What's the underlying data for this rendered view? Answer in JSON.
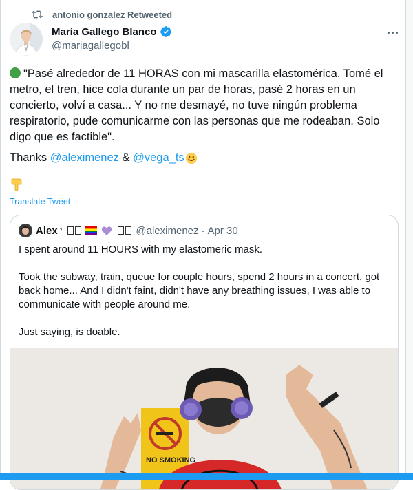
{
  "retweet": {
    "label": "antonio gonzalez Retweeted"
  },
  "author": {
    "name": "María Gallego Blanco",
    "handle": "@mariagallegobl"
  },
  "tweet": {
    "body": "\"Pasé alrededor de 11 HORAS con mi mascarilla elastomérica.  Tomé el metro, el tren, hice cola durante un par de horas, pasé 2 horas en un concierto, volví a casa... Y no me desmayé, no tuve ningún problema respiratorio, pude comunicarme con las personas que me rodeaban.  Solo digo que es factible\".",
    "thanks_prefix": "Thanks ",
    "mention_1": "@aleximenez",
    "thanks_and": " & ",
    "mention_2": "@vega_ts",
    "translate": "Translate Tweet"
  },
  "quote": {
    "name": "Alex",
    "superscript": "⁷",
    "handle": "@aleximenez",
    "separator": "·",
    "date": "Apr 30",
    "paragraphs": [
      "I spent around 11 HOURS with my elastomeric mask.",
      "Took the subway, train, queue for couple hours, spend 2 hours in a concert, got back home... And I didn't faint, didn't have any breathing issues, I was able to communicate with people around me.",
      "Just saying, is doable."
    ],
    "photo_sign": "NO SMOKING"
  },
  "icons": [
    "retweet-icon",
    "verified-badge-icon",
    "more-icon",
    "green-circle-emoji",
    "smile-emoji-icon",
    "point-down-emoji-icon",
    "rainbow-flag-icon",
    "purple-heart-icon"
  ],
  "colors": {
    "accent": "#1d9bf0",
    "secondary_text": "#536471",
    "border": "#cfd9de",
    "verified": "#1d9bf0"
  }
}
